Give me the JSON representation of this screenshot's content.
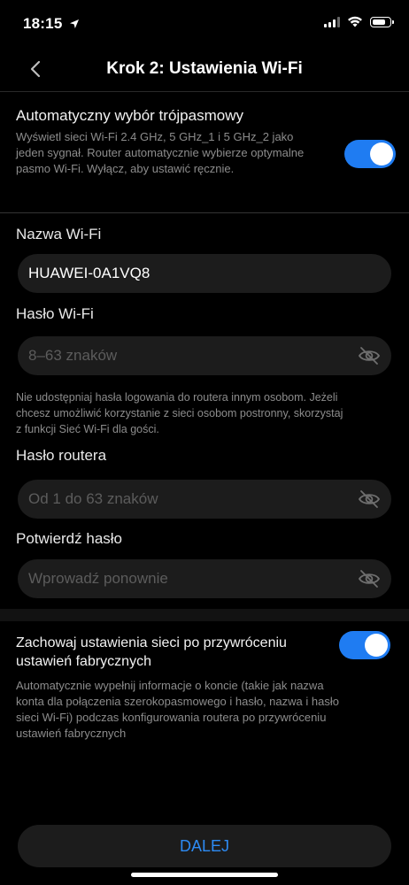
{
  "status": {
    "time": "18:15"
  },
  "nav": {
    "title": "Krok 2: Ustawienia Wi-Fi",
    "back_icon": "chevron-left-icon"
  },
  "tri_band": {
    "title": "Automatyczny wybór trójpasmowy",
    "hint_lines": [
      "Wyświetl sieci Wi-Fi 2.4 GHz, 5 GHz_1 i 5 GHz_2 jako",
      "jeden sygnał. Router automatycznie wybierze optymalne",
      "pasmo Wi-Fi. Wyłącz, aby ustawić ręcznie."
    ],
    "enabled": true
  },
  "wifi_name": {
    "label": "Nazwa Wi-Fi",
    "value": "HUAWEI-0A1VQ8"
  },
  "wifi_password": {
    "label": "Hasło Wi-Fi",
    "placeholder": "8–63 znaków",
    "hint_lines": [
      "Nie udostępniaj hasła logowania do routera innym osobom. Jeżeli",
      "chcesz umożliwić korzystanie z sieci osobom postronny, skorzystaj",
      "z funkcji Sieć Wi-Fi dla gości."
    ]
  },
  "router_password": {
    "label": "Hasło routera",
    "placeholder": "Od 1 do 63 znaków"
  },
  "confirm_password": {
    "label": "Potwierdź hasło",
    "placeholder": "Wprowadź ponownie"
  },
  "keep_settings": {
    "title_lines": [
      "Zachowaj ustawienia sieci po przywróceniu",
      "ustawień fabrycznych"
    ],
    "hint_lines": [
      "Automatycznie wypełnij informacje o koncie (takie jak nazwa",
      "konta dla połączenia szerokopasmowego i hasło, nazwa i hasło",
      "sieci Wi-Fi) podczas konfigurowania routera po przywróceniu",
      "ustawień fabrycznych"
    ],
    "enabled": true
  },
  "next_button": {
    "label": "DALEJ"
  },
  "colors": {
    "accent": "#1f7cf2",
    "link": "#2d8bf4",
    "field_bg": "#1c1c1c"
  }
}
